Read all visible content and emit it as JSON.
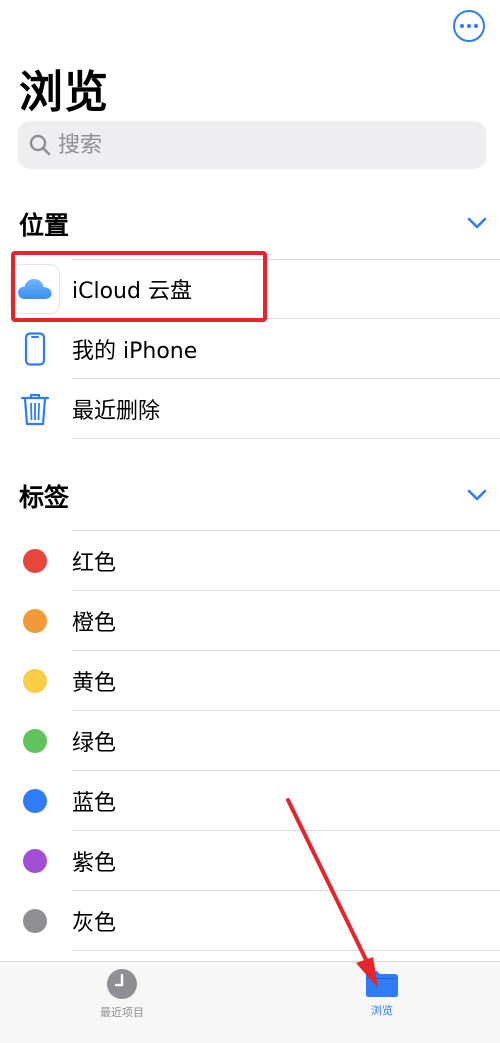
{
  "header": {
    "title": "浏览"
  },
  "search": {
    "placeholder": "搜索"
  },
  "locations": {
    "title": "位置",
    "items": [
      {
        "label": "iCloud 云盘",
        "icon": "icloud-icon"
      },
      {
        "label": "我的 iPhone",
        "icon": "iphone-icon"
      },
      {
        "label": "最近删除",
        "icon": "trash-icon"
      }
    ]
  },
  "tags": {
    "title": "标签",
    "items": [
      {
        "label": "红色",
        "color": "#e8453c"
      },
      {
        "label": "橙色",
        "color": "#f29a38"
      },
      {
        "label": "黄色",
        "color": "#f7ce46"
      },
      {
        "label": "绿色",
        "color": "#5fc45b"
      },
      {
        "label": "蓝色",
        "color": "#2f7cf6"
      },
      {
        "label": "紫色",
        "color": "#a24fd6"
      },
      {
        "label": "灰色",
        "color": "#8e8e93"
      }
    ]
  },
  "tabbar": {
    "recents": {
      "label": "最近项目"
    },
    "browse": {
      "label": "浏览",
      "active": true
    }
  },
  "colors": {
    "accent": "#2f7cf6",
    "annotation": "#e8242b"
  }
}
